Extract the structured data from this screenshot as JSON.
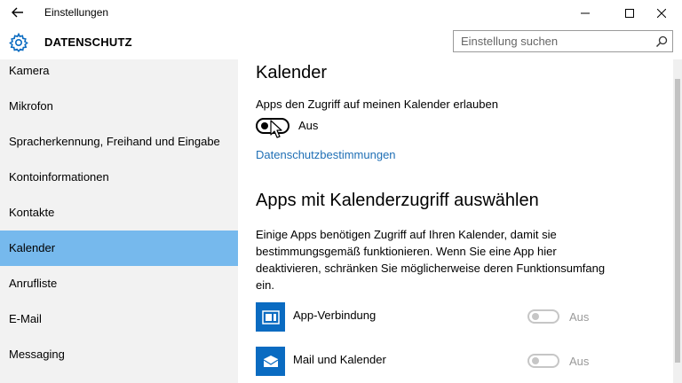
{
  "window": {
    "title": "Einstellungen"
  },
  "header": {
    "title": "DATENSCHUTZ",
    "search_placeholder": "Einstellung suchen"
  },
  "sidebar": {
    "items": [
      {
        "label": "Kamera",
        "active": false
      },
      {
        "label": "Mikrofon",
        "active": false
      },
      {
        "label": "Spracherkennung, Freihand und Eingabe",
        "active": false
      },
      {
        "label": "Kontoinformationen",
        "active": false
      },
      {
        "label": "Kontakte",
        "active": false
      },
      {
        "label": "Kalender",
        "active": true
      },
      {
        "label": "Anrufliste",
        "active": false
      },
      {
        "label": "E-Mail",
        "active": false
      },
      {
        "label": "Messaging",
        "active": false
      }
    ]
  },
  "main": {
    "title": "Kalender",
    "allow_label": "Apps den Zugriff auf meinen Kalender erlauben",
    "toggle_state": "Aus",
    "privacy_link": "Datenschutzbestimmungen",
    "section_title": "Apps mit Kalenderzugriff auswählen",
    "description": "Einige Apps benötigen Zugriff auf Ihren Kalender, damit sie bestimmungsgemäß funktionieren. Wenn Sie eine App hier deaktivieren, schränken Sie möglicherweise deren Funktionsumfang ein.",
    "apps": [
      {
        "name": "App-Verbindung",
        "state": "Aus",
        "icon": "app-connector-icon"
      },
      {
        "name": "Mail und Kalender",
        "state": "Aus",
        "icon": "mail-icon"
      }
    ]
  },
  "colors": {
    "accent": "#0a6bc1",
    "nav_selected": "#76b9ed",
    "link": "#1f6fb5"
  }
}
